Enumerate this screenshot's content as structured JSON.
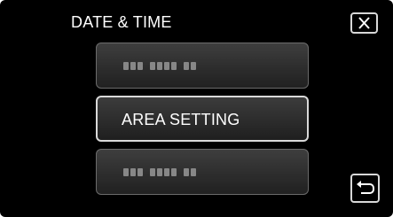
{
  "header": {
    "title": "DATE & TIME"
  },
  "buttons": {
    "close_icon": "close-icon",
    "back_icon": "return-icon"
  },
  "menu": {
    "items": [
      {
        "label": "",
        "state": "blurred"
      },
      {
        "label": "AREA SETTING",
        "state": "selected"
      },
      {
        "label": "",
        "state": "blurred"
      }
    ]
  },
  "colors": {
    "background": "#000000",
    "text": "#ffffff",
    "button_border": "#7a7a7a",
    "selected_border": "#d9d9d9"
  }
}
